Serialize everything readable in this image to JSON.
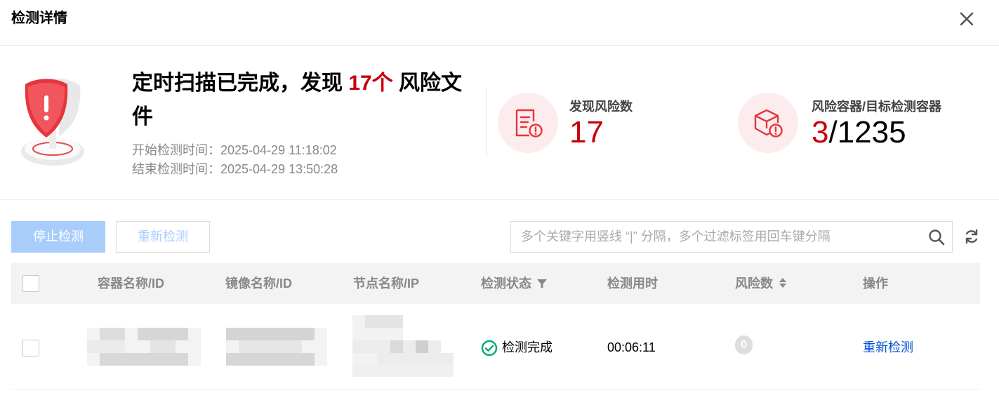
{
  "dialog": {
    "title": "检测详情",
    "close_icon": "close-icon"
  },
  "summary": {
    "headline_prefix": "定时扫描已完成，发现 ",
    "risk_count_text": "17个",
    "headline_suffix": " 风险文件",
    "start_time": "开始检测时间：2025-04-29 11:18:02",
    "end_time": "结束检测时间：2025-04-29 13:50:28",
    "shield_icon": "shield-warning-icon",
    "stats": {
      "risks": {
        "label": "发现风险数",
        "value": "17",
        "icon": "document-warning-icon"
      },
      "containers": {
        "label": "风险容器/目标检测容器",
        "risk_value": "3",
        "total_value": "/1235",
        "icon": "box-warning-icon"
      }
    }
  },
  "toolbar": {
    "stop_label": "停止检测",
    "rescan_label": "重新检测",
    "search_placeholder": "多个关键字用竖线 “|” 分隔，多个过滤标签用回车键分隔",
    "search_icon": "search-icon",
    "refresh_icon": "refresh-icon"
  },
  "table": {
    "columns": [
      "容器名称/ID",
      "镜像名称/ID",
      "节点名称/IP",
      "检测状态",
      "检测用时",
      "风险数",
      "操作"
    ],
    "rows": [
      {
        "container": "",
        "image": "",
        "node": "",
        "status": "检测完成",
        "duration": "00:06:11",
        "risk_count": "0",
        "action": "重新检测"
      }
    ]
  },
  "colors": {
    "accent_red": "#c7000b",
    "primary_blue": "#0052d9",
    "disabled_blue": "#a9cdfb",
    "success_green": "#00a870"
  }
}
